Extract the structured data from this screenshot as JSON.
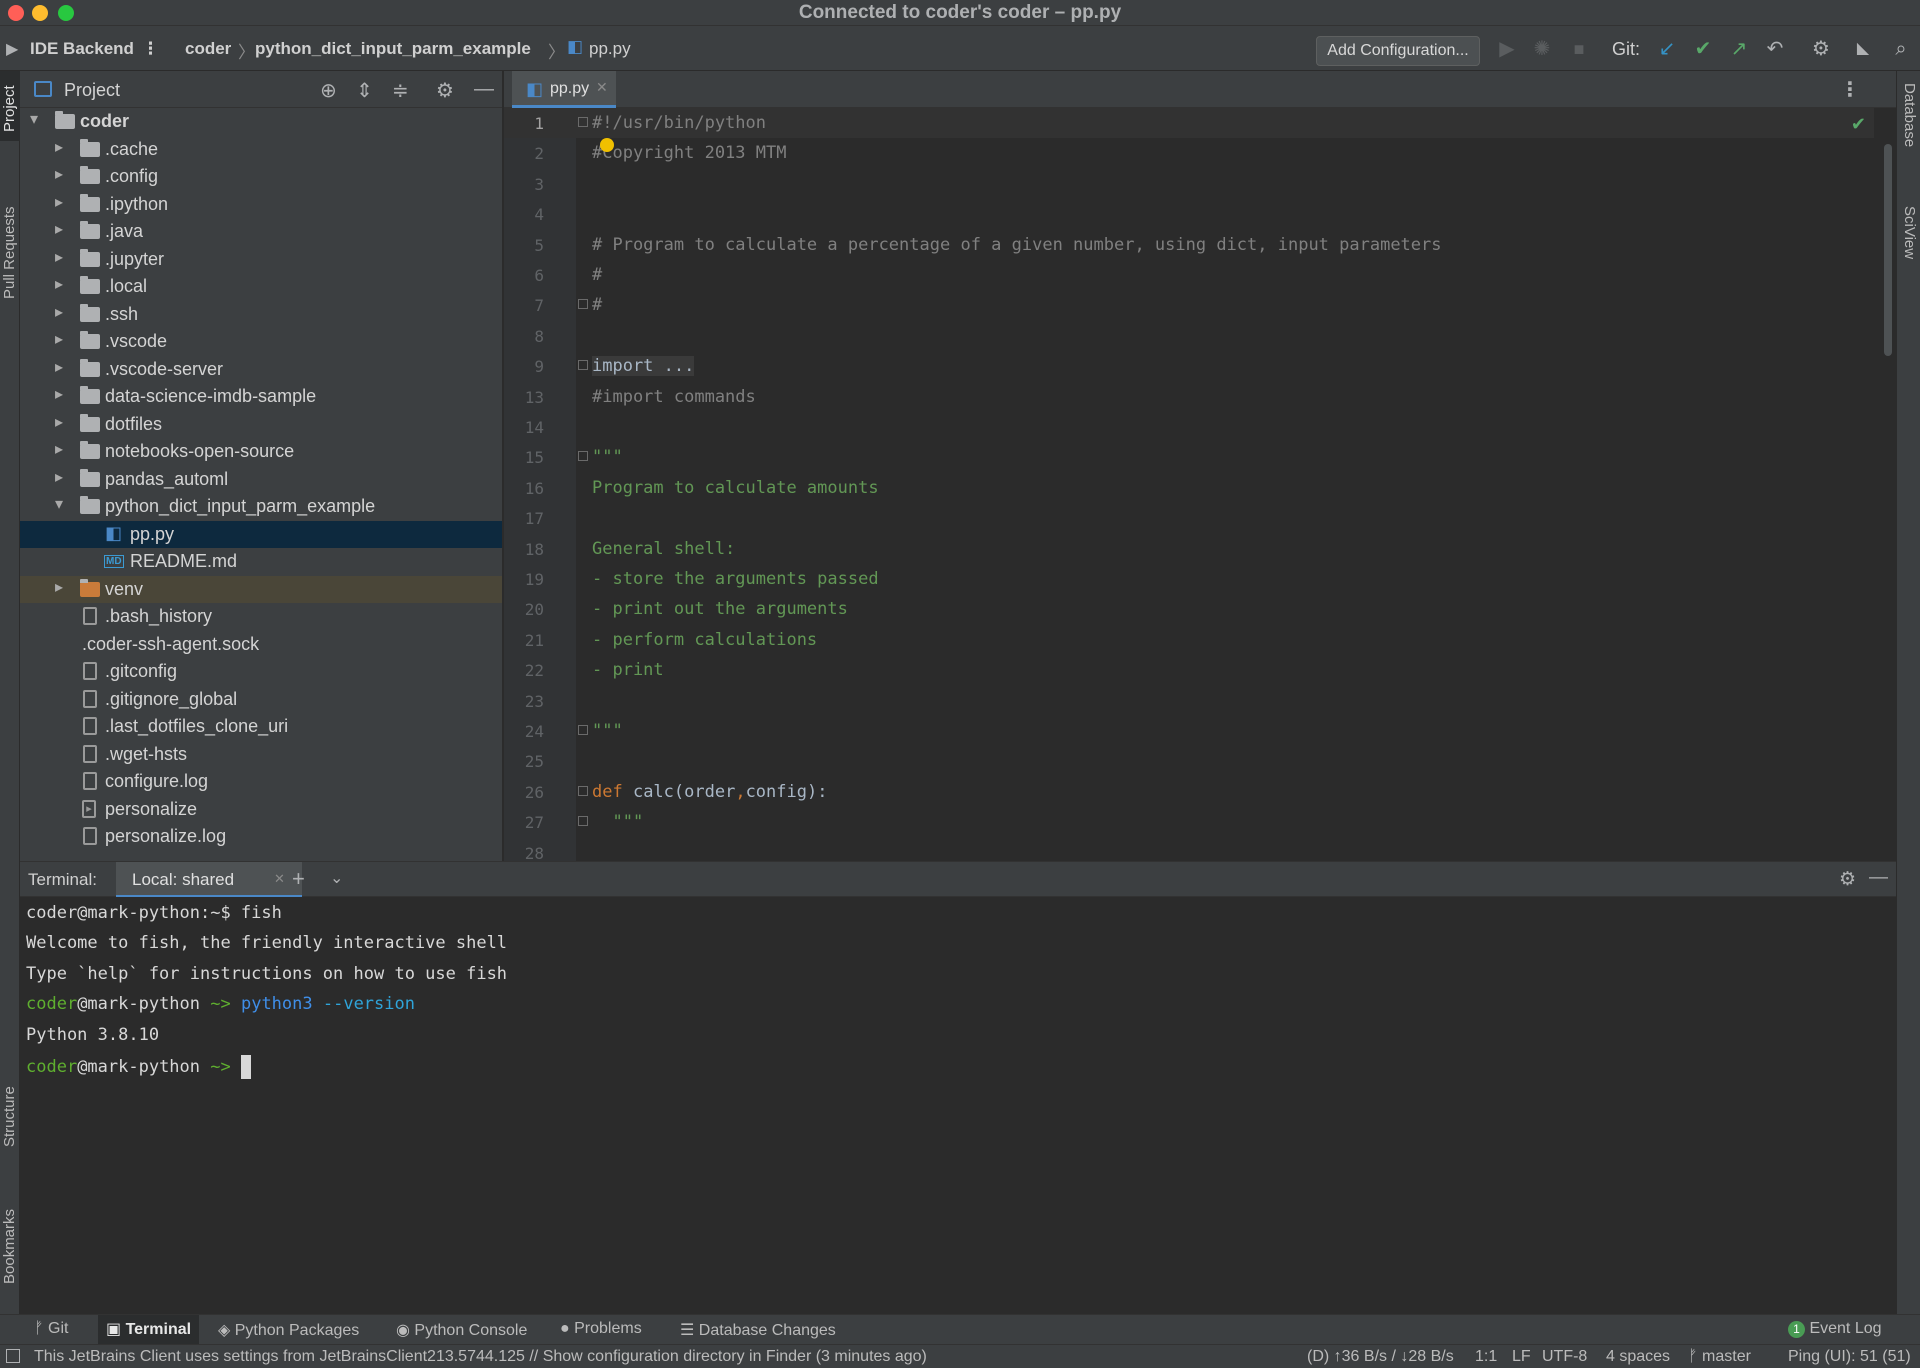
{
  "window": {
    "title": "Connected to coder's coder – pp.py"
  },
  "navbar": {
    "backend_label": "IDE Backend",
    "breadcrumbs": [
      "coder",
      "python_dict_input_parm_example",
      "pp.py"
    ],
    "add_config_label": "Add Configuration...",
    "git_label": "Git:"
  },
  "left_tabs": {
    "project": "Project",
    "pull_requests": "Pull Requests",
    "structure": "Structure",
    "bookmarks": "Bookmarks"
  },
  "right_tabs": {
    "database": "Database",
    "sciview": "SciView"
  },
  "project_panel": {
    "title": "Project",
    "root": "coder",
    "items": [
      {
        "label": ".cache",
        "kind": "folder"
      },
      {
        "label": ".config",
        "kind": "folder"
      },
      {
        "label": ".ipython",
        "kind": "folder"
      },
      {
        "label": ".java",
        "kind": "folder"
      },
      {
        "label": ".jupyter",
        "kind": "folder"
      },
      {
        "label": ".local",
        "kind": "folder"
      },
      {
        "label": ".ssh",
        "kind": "folder"
      },
      {
        "label": ".vscode",
        "kind": "folder"
      },
      {
        "label": ".vscode-server",
        "kind": "folder"
      },
      {
        "label": "data-science-imdb-sample",
        "kind": "folder"
      },
      {
        "label": "dotfiles",
        "kind": "folder"
      },
      {
        "label": "notebooks-open-source",
        "kind": "folder"
      },
      {
        "label": "pandas_automl",
        "kind": "folder"
      },
      {
        "label": "python_dict_input_parm_example",
        "kind": "folder-open"
      },
      {
        "label": "pp.py",
        "kind": "python-file"
      },
      {
        "label": "README.md",
        "kind": "md-file"
      },
      {
        "label": "venv",
        "kind": "folder-excluded"
      },
      {
        "label": ".bash_history",
        "kind": "file"
      },
      {
        "label": ".coder-ssh-agent.sock",
        "kind": "plain"
      },
      {
        "label": ".gitconfig",
        "kind": "file"
      },
      {
        "label": ".gitignore_global",
        "kind": "file"
      },
      {
        "label": ".last_dotfiles_clone_uri",
        "kind": "file"
      },
      {
        "label": ".wget-hsts",
        "kind": "file"
      },
      {
        "label": "configure.log",
        "kind": "file"
      },
      {
        "label": "personalize",
        "kind": "exec-file"
      },
      {
        "label": "personalize.log",
        "kind": "file"
      }
    ]
  },
  "editor": {
    "tab_label": "pp.py",
    "lines": [
      {
        "n": "1",
        "text": "#!/usr/bin/python",
        "style": "comment"
      },
      {
        "n": "2",
        "text": "#Copyright 2013 MTM",
        "style": "comment"
      },
      {
        "n": "3",
        "text": "",
        "style": "plain"
      },
      {
        "n": "4",
        "text": "",
        "style": "plain"
      },
      {
        "n": "5",
        "text": "# Program to calculate a percentage of a given number, using dict, input parameters",
        "style": "comment"
      },
      {
        "n": "6",
        "text": "#",
        "style": "comment"
      },
      {
        "n": "7",
        "text": "#",
        "style": "comment"
      },
      {
        "n": "8",
        "text": "",
        "style": "plain"
      },
      {
        "n": "9",
        "text": "import ...",
        "style": "plain"
      },
      {
        "n": "13",
        "text": "#import commands",
        "style": "comment"
      },
      {
        "n": "14",
        "text": "",
        "style": "plain"
      },
      {
        "n": "15",
        "text": "\"\"\"",
        "style": "doc"
      },
      {
        "n": "16",
        "text": "Program to calculate amounts",
        "style": "doc"
      },
      {
        "n": "17",
        "text": "",
        "style": "plain"
      },
      {
        "n": "18",
        "text": "General shell:",
        "style": "doc"
      },
      {
        "n": "19",
        "text": "- store the arguments passed",
        "style": "doc"
      },
      {
        "n": "20",
        "text": "- print out the arguments",
        "style": "doc"
      },
      {
        "n": "21",
        "text": "- perform calculations",
        "style": "doc"
      },
      {
        "n": "22",
        "text": "- print",
        "style": "doc"
      },
      {
        "n": "23",
        "text": "",
        "style": "plain"
      },
      {
        "n": "24",
        "text": "\"\"\"",
        "style": "doc"
      },
      {
        "n": "25",
        "text": "",
        "style": "plain"
      },
      {
        "n": "26",
        "kw": "def",
        "text": " calc(order",
        "sep": ",",
        "rest": "config):",
        "style": "def"
      },
      {
        "n": "27",
        "text": "  \"\"\"",
        "style": "doc"
      },
      {
        "n": "28",
        "text": "",
        "style": "plain"
      }
    ]
  },
  "terminal": {
    "label": "Terminal:",
    "tab": "Local: shared",
    "lines": {
      "l1": "coder@mark-python:~$ fish",
      "l2": "Welcome to fish, the friendly interactive shell",
      "l3": "Type `help` for instructions on how to use fish",
      "l4_user": "coder",
      "l4_host": "@mark-python ",
      "l4_prompt": "~> ",
      "l4_cmd": "python3",
      "l4_arg": " --version",
      "l5": "Python 3.8.10",
      "l6_user": "coder",
      "l6_host": "@mark-python ",
      "l6_prompt": "~> "
    }
  },
  "bottom_tabs": {
    "git": "Git",
    "terminal": "Terminal",
    "python_packages": "Python Packages",
    "python_console": "Python Console",
    "problems": "Problems",
    "database_changes": "Database Changes",
    "event_log": "Event Log",
    "event_log_count": "1"
  },
  "statusbar": {
    "message": "This JetBrains Client uses settings from JetBrainsClient213.5744.125 // Show configuration directory in Finder (3 minutes ago)",
    "network": "(D) ↑36 B/s / ↓28 B/s",
    "position": "1:1",
    "line_sep": "LF",
    "encoding": "UTF-8",
    "indent": "4 spaces",
    "branch": "master",
    "ping": "Ping (UI): 51 (51)"
  },
  "colors": {
    "background": "#2b2b2b",
    "panel": "#3c3f41",
    "selection": "#0d293e",
    "accent": "#4a88c7",
    "doc_string": "#629755",
    "keyword": "#cc7832"
  }
}
